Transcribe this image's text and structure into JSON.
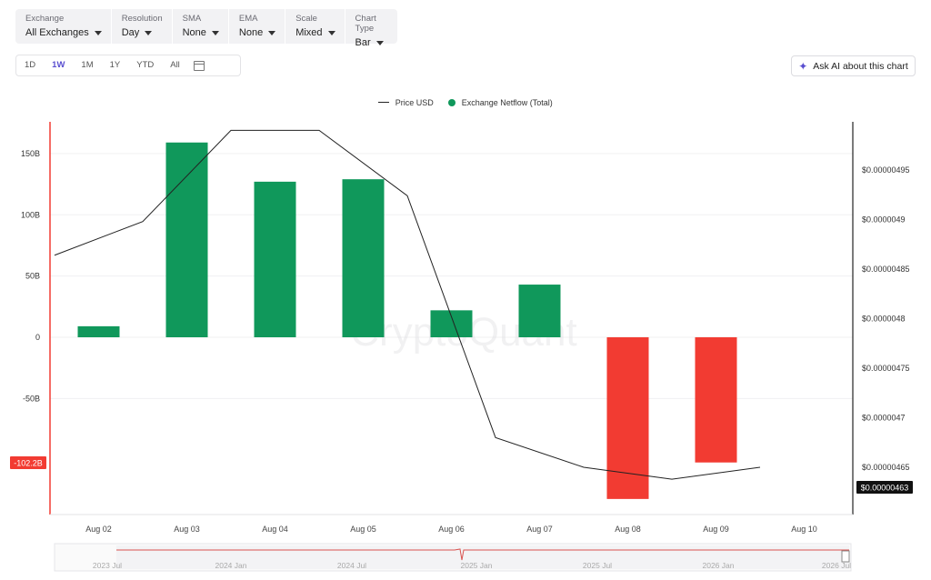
{
  "toolbar": [
    {
      "label": "Exchange",
      "value": "All Exchanges"
    },
    {
      "label": "Resolution",
      "value": "Day"
    },
    {
      "label": "SMA",
      "value": "None"
    },
    {
      "label": "EMA",
      "value": "None"
    },
    {
      "label": "Scale",
      "value": "Mixed"
    },
    {
      "label": "Chart Type",
      "value": "Bar"
    }
  ],
  "ranges": [
    "1D",
    "1W",
    "1M",
    "1Y",
    "YTD",
    "All"
  ],
  "active_range": "1W",
  "ask_ai": "Ask AI about this chart",
  "watermark": "CryptoQuant",
  "colors": {
    "positive": "#10985b",
    "negative": "#f23b32",
    "line": "#222222",
    "accent": "#5a4fd0"
  },
  "chart_data": {
    "type": "bar",
    "categories": [
      "Aug 02",
      "Aug 03",
      "Aug 04",
      "Aug 05",
      "Aug 06",
      "Aug 07",
      "Aug 08",
      "Aug 09",
      "Aug 10"
    ],
    "series": [
      {
        "name": "Exchange Netflow (Total)",
        "type": "bar",
        "axis": "left",
        "values": [
          9,
          159,
          127,
          129,
          22,
          43,
          -132,
          -102.2,
          null
        ]
      },
      {
        "name": "Price USD",
        "type": "line",
        "axis": "right",
        "values": [
          4.898e-06,
          4.99e-06,
          4.99e-06,
          4.924e-06,
          4.68e-06,
          4.65e-06,
          4.638e-06,
          4.65e-06,
          null
        ],
        "start_value": 4.864e-06
      }
    ],
    "left_axis": {
      "ticks": [
        150,
        100,
        50,
        0,
        -50
      ],
      "tick_labels": [
        "150B",
        "100B",
        "50B",
        "0",
        "-50B"
      ],
      "range": [
        -143,
        172
      ]
    },
    "right_axis": {
      "ticks": [
        4.95e-06,
        4.9e-06,
        4.85e-06,
        4.8e-06,
        4.75e-06,
        4.7e-06,
        4.65e-06
      ],
      "tick_labels": [
        "$0.00000495",
        "$0.0000049",
        "$0.00000485",
        "$0.0000048",
        "$0.00000475",
        "$0.0000047",
        "$0.00000465"
      ],
      "range": [
        4.618e-06,
        5.027e-06
      ]
    },
    "last_left_label": "-102.2B",
    "last_price_label": "$0.00000463",
    "legend": [
      "Price USD",
      "Exchange Netflow (Total)"
    ],
    "legend_position": "top-center",
    "navigator_labels": [
      "2023 Jul",
      "2024 Jan",
      "2024 Jul",
      "2025 Jan",
      "2025 Jul",
      "2026 Jan",
      "2026 Jul"
    ]
  }
}
